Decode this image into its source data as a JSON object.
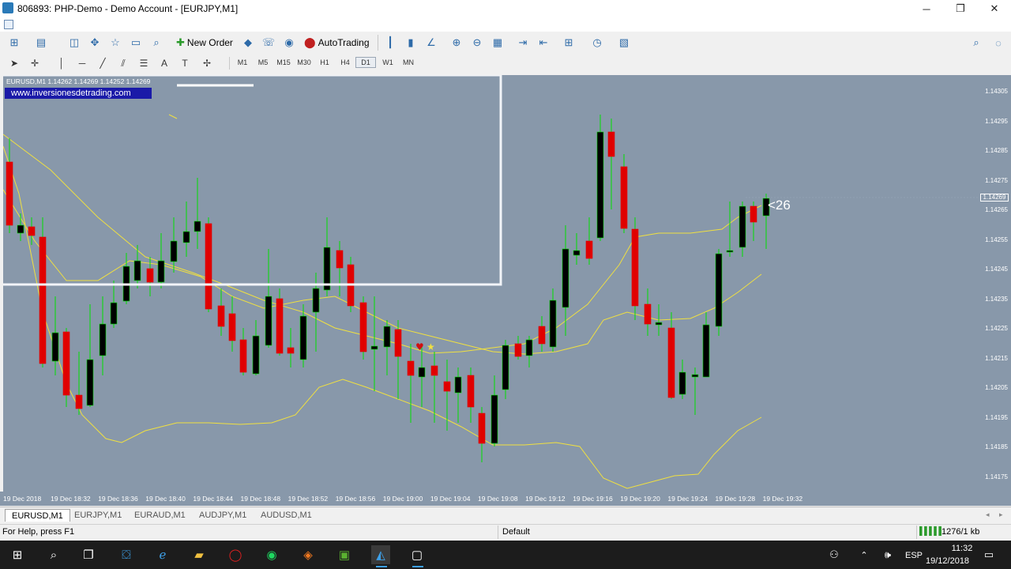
{
  "window": {
    "title": "806893: PHP-Demo - Demo Account - [EURJPY,M1]",
    "controls": [
      "minimize",
      "restore",
      "close"
    ]
  },
  "toolbar": {
    "new_order_label": "New Order",
    "auto_trading_label": "AutoTrading",
    "timeframes": [
      "M1",
      "M5",
      "M15",
      "M30",
      "H1",
      "H4",
      "D1",
      "W1",
      "MN"
    ],
    "active_timeframe": "D1"
  },
  "chart": {
    "symbol_info": "EURUSD,M1  1.14262 1.14269 1.14252 1.14269",
    "watermark_link": "www.inversionesdetrading.com",
    "price_label": "<26",
    "current_price": "1.14269",
    "price_ticks": [
      "1.14305",
      "1.14295",
      "1.14285",
      "1.14275",
      "1.14265",
      "1.14255",
      "1.14245",
      "1.14235",
      "1.14225",
      "1.14215",
      "1.14205",
      "1.14195",
      "1.14185",
      "1.14175"
    ],
    "time_ticks": [
      "19 Dec 2018",
      "19 Dec 18:32",
      "19 Dec 18:36",
      "19 Dec 18:40",
      "19 Dec 18:44",
      "19 Dec 18:48",
      "19 Dec 18:52",
      "19 Dec 18:56",
      "19 Dec 19:00",
      "19 Dec 19:04",
      "19 Dec 19:08",
      "19 Dec 19:12",
      "19 Dec 19:16",
      "19 Dec 19:20",
      "19 Dec 19:24",
      "19 Dec 19:28",
      "19 Dec 19:32"
    ],
    "colors": {
      "background": "#8898aa",
      "bull": "#000000",
      "bear": "#e00000",
      "wick": "#00e000",
      "bands": "#f0e040"
    }
  },
  "tabs": [
    "EURUSD,M1",
    "EURJPY,M1",
    "EURAUD,M1",
    "AUDJPY,M1",
    "AUDUSD,M1"
  ],
  "active_tab": "EURUSD,M1",
  "status": {
    "help": "For Help, press F1",
    "profile": "Default",
    "traffic": "1276/1 kb"
  },
  "taskbar": {
    "time": "11:32",
    "date": "19/12/2018",
    "language": "ESP"
  }
}
